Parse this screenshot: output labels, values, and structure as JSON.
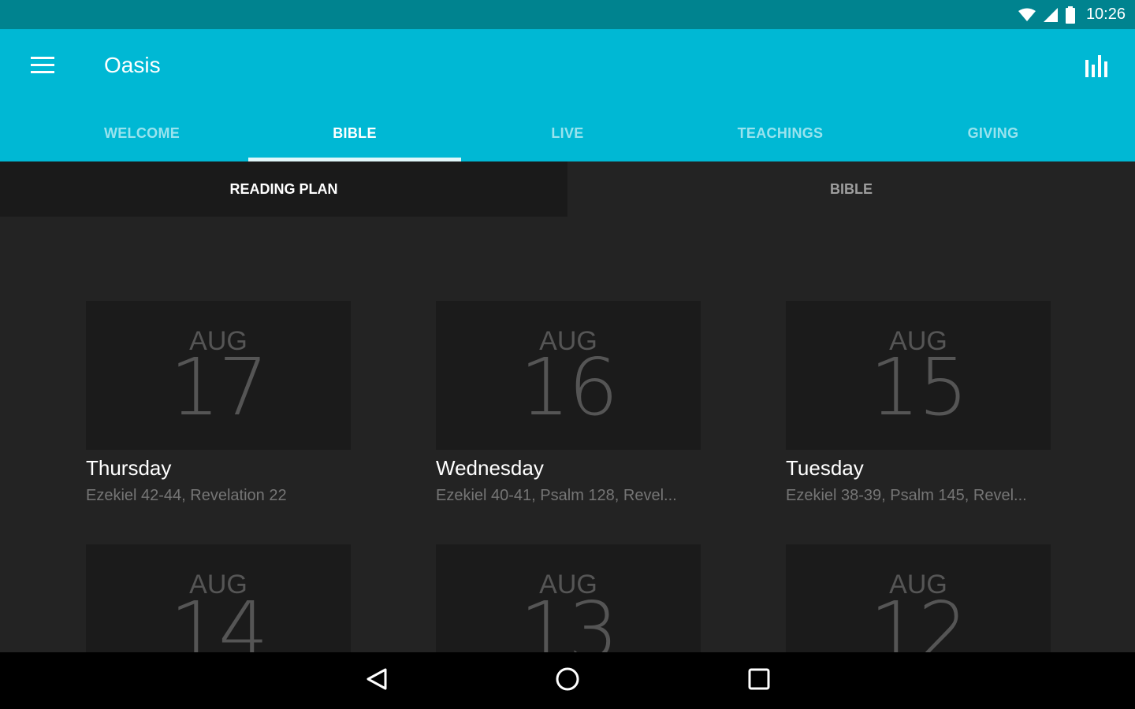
{
  "status_bar": {
    "time": "10:26",
    "icons": [
      "wifi-icon",
      "cell-signal-icon",
      "battery-icon"
    ]
  },
  "app_bar": {
    "title": "Oasis",
    "menu_icon": "menu-icon",
    "action_icon": "bar-chart-icon",
    "color": "#00b8d4"
  },
  "tabs": [
    {
      "label": "WELCOME",
      "active": false
    },
    {
      "label": "BIBLE",
      "active": true
    },
    {
      "label": "LIVE",
      "active": false
    },
    {
      "label": "TEACHINGS",
      "active": false
    },
    {
      "label": "GIVING",
      "active": false
    }
  ],
  "subtabs": [
    {
      "label": "READING PLAN",
      "active": true
    },
    {
      "label": "BIBLE",
      "active": false
    }
  ],
  "cards": [
    {
      "month": "AUG",
      "day": "17",
      "weekday": "Thursday",
      "passages": "Ezekiel 42-44, Revelation 22"
    },
    {
      "month": "AUG",
      "day": "16",
      "weekday": "Wednesday",
      "passages": "Ezekiel 40-41, Psalm 128, Revel..."
    },
    {
      "month": "AUG",
      "day": "15",
      "weekday": "Tuesday",
      "passages": "Ezekiel 38-39, Psalm 145, Revel..."
    },
    {
      "month": "AUG",
      "day": "14",
      "weekday": "",
      "passages": ""
    },
    {
      "month": "AUG",
      "day": "13",
      "weekday": "",
      "passages": ""
    },
    {
      "month": "AUG",
      "day": "12",
      "weekday": "",
      "passages": ""
    }
  ],
  "nav_bar": {
    "icons": [
      "back-icon",
      "home-icon",
      "recents-icon"
    ]
  }
}
